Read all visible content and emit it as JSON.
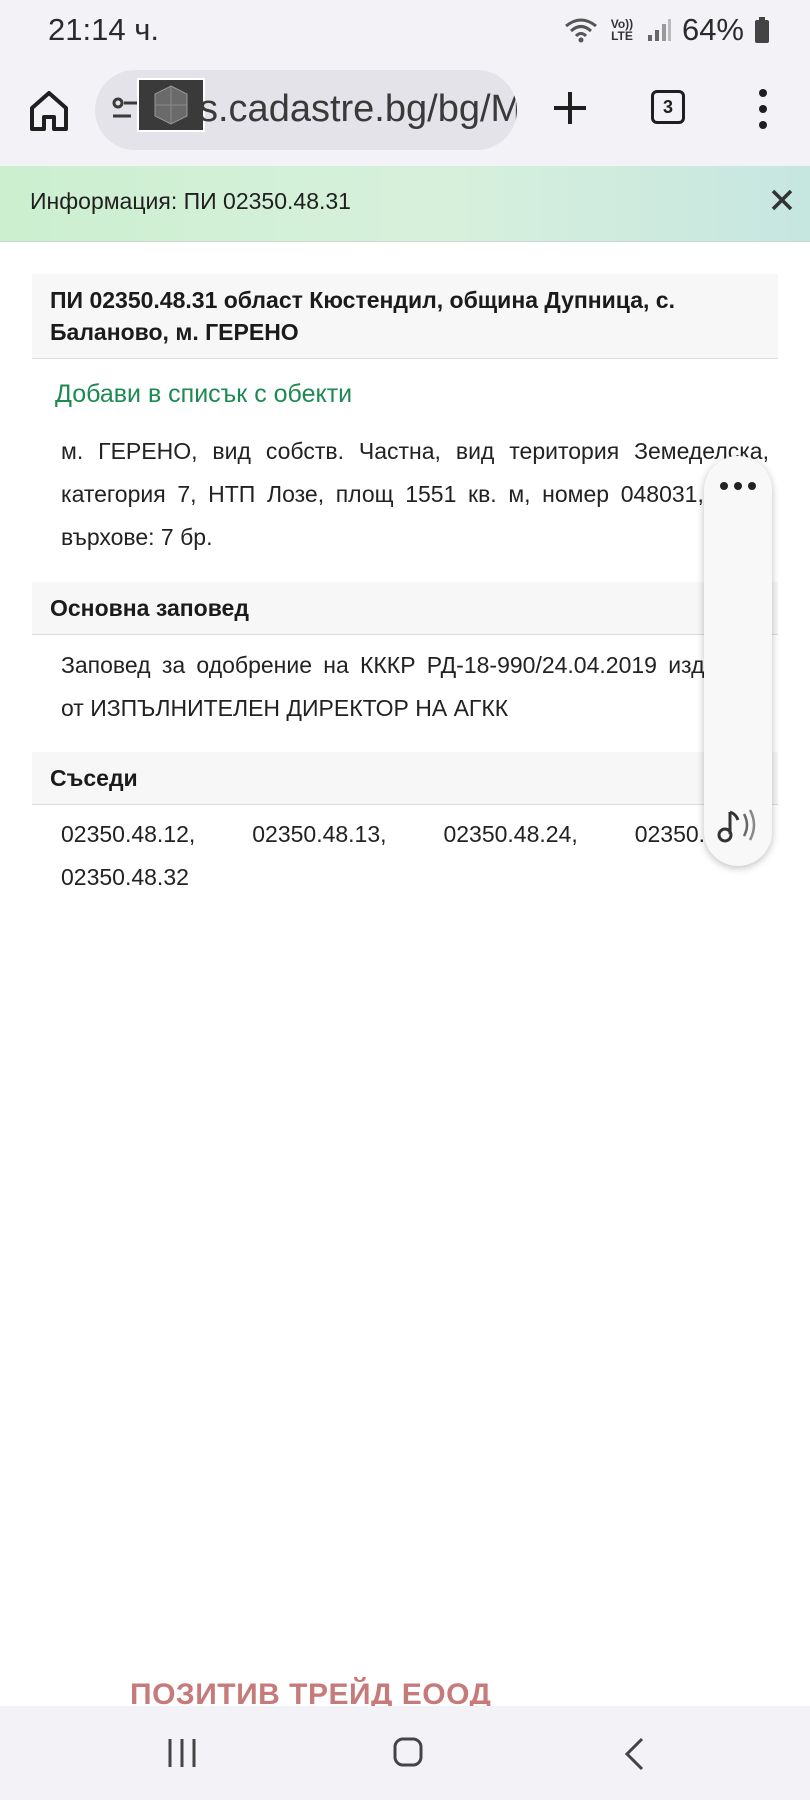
{
  "status_bar": {
    "time": "21:14 ч.",
    "lte_label": "Vo)) LTE",
    "battery_pct": "64%"
  },
  "browser": {
    "url": "s.cadastre.bg/bg/M",
    "tab_count": "3"
  },
  "info_banner": {
    "text": "Информация: ПИ 02350.48.31"
  },
  "property": {
    "title": "ПИ 02350.48.31 област Кюстендил, община Дупница, с. Баланово, м. ГЕРЕНО",
    "add_link": "Добави в списък с обекти",
    "description": "м. ГЕРЕНО, вид собств. Частна, вид територия Земеделска, категория 7, НТП Лозе, площ 1551 кв. м, номер 048031, Брой върхове: 7 бр."
  },
  "order_section": {
    "heading": "Основна заповед",
    "text": "Заповед за одобрение на КККР РД-18-990/24.04.2019 издадена от ИЗПЪЛНИТЕЛЕН ДИРЕКТОР НА АГКК"
  },
  "neighbors_section": {
    "heading": "Съседи",
    "text": "02350.48.12, 02350.48.13, 02350.48.24, 02350.48.30, 02350.48.32"
  },
  "watermark": "ПОЗИТИВ ТРЕЙД ЕООД",
  "icons": {
    "home": "home-icon",
    "tune": "tune-icon",
    "plus": "plus-icon",
    "tabs": "tab-switcher-icon",
    "menu": "more-vertical-icon",
    "close": "close-icon",
    "more": "more-horizontal-icon",
    "read_aloud": "read-aloud-icon"
  },
  "colors": {
    "link": "#1d8a52",
    "banner": "#d2efd7",
    "watermark": "#c77a7a"
  }
}
